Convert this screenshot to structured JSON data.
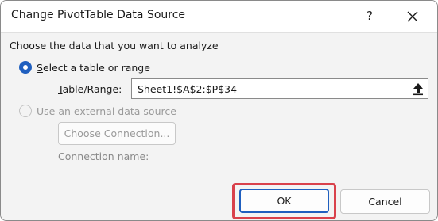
{
  "dialog": {
    "title": "Change PivotTable Data Source",
    "help_label": "?",
    "prompt": "Choose the data that you want to analyze"
  },
  "options": {
    "table_range": {
      "selected": true,
      "label_underlined": "S",
      "label_rest": "elect a table or range"
    },
    "range_field": {
      "label_underlined": "T",
      "label_rest": "able/Range:",
      "value": "Sheet1!$A$2:$P$34"
    },
    "external": {
      "selected": false,
      "label": "Use an external data source",
      "choose_connection_label": "Choose Connection...",
      "connection_name_label": "Connection name:"
    }
  },
  "footer": {
    "ok_label": "OK",
    "cancel_label": "Cancel"
  },
  "colors": {
    "accent": "#1f5fbf",
    "highlight": "#d9414b",
    "disabled_text": "#9a9a9a"
  },
  "icons": {
    "close": "close-icon",
    "collapse": "collapse-dialog-icon"
  }
}
